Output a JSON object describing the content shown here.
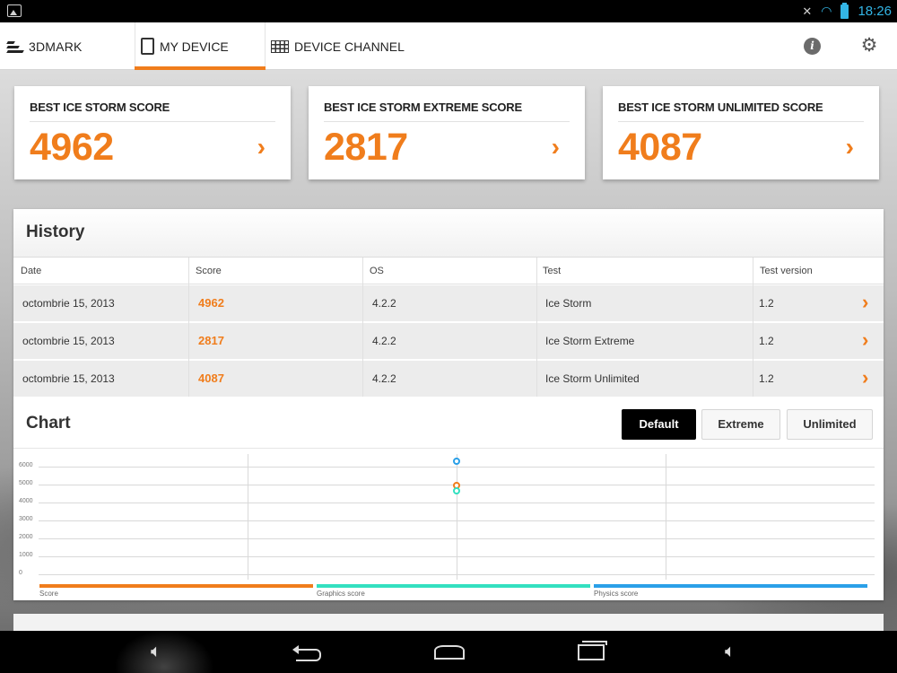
{
  "statusbar": {
    "time": "18:26",
    "icons": [
      "gallery-icon",
      "mute-icon",
      "wifi-icon",
      "battery-icon"
    ]
  },
  "topbar": {
    "logo_label": "3DMARK",
    "tabs": [
      {
        "label": "MY DEVICE",
        "icon": "tablet-icon",
        "active": true
      },
      {
        "label": "DEVICE CHANNEL",
        "icon": "grid-icon",
        "active": false
      }
    ],
    "actions": [
      "info-icon",
      "gear-icon"
    ]
  },
  "cards": [
    {
      "title": "BEST ICE STORM SCORE",
      "score": "4962"
    },
    {
      "title": "BEST ICE STORM EXTREME SCORE",
      "score": "2817"
    },
    {
      "title": "BEST ICE STORM UNLIMITED SCORE",
      "score": "4087"
    }
  ],
  "history": {
    "title": "History",
    "columns": [
      "Date",
      "Score",
      "OS",
      "Test",
      "Test version"
    ],
    "rows": [
      {
        "date": "octombrie 15, 2013",
        "score": "4962",
        "os": "4.2.2",
        "test": "Ice Storm",
        "version": "1.2"
      },
      {
        "date": "octombrie 15, 2013",
        "score": "2817",
        "os": "4.2.2",
        "test": "Ice Storm Extreme",
        "version": "1.2"
      },
      {
        "date": "octombrie 15, 2013",
        "score": "4087",
        "os": "4.2.2",
        "test": "Ice Storm Unlimited",
        "version": "1.2"
      }
    ]
  },
  "chart_section": {
    "title": "Chart",
    "buttons": [
      "Default",
      "Extreme",
      "Unlimited"
    ],
    "selected": "Default"
  },
  "chart_data": {
    "type": "scatter",
    "y_ticks": [
      "6000",
      "5000",
      "4000",
      "3000",
      "2000",
      "1000",
      "0"
    ],
    "ylim": [
      0,
      6000
    ],
    "series": [
      {
        "name": "Score",
        "color": "#f07d1c",
        "values": [
          4962
        ]
      },
      {
        "name": "Graphics score",
        "color": "#33e0c0",
        "values": [
          4650
        ]
      },
      {
        "name": "Physics score",
        "color": "#2aa0e8",
        "values": [
          6300
        ]
      }
    ],
    "grid": true
  },
  "colors": {
    "accent": "#f07d1c",
    "status_blue": "#33b5e5"
  },
  "navbar": {
    "icons": [
      "volume-down-icon",
      "back-icon",
      "home-icon",
      "recent-apps-icon",
      "volume-up-icon"
    ]
  }
}
